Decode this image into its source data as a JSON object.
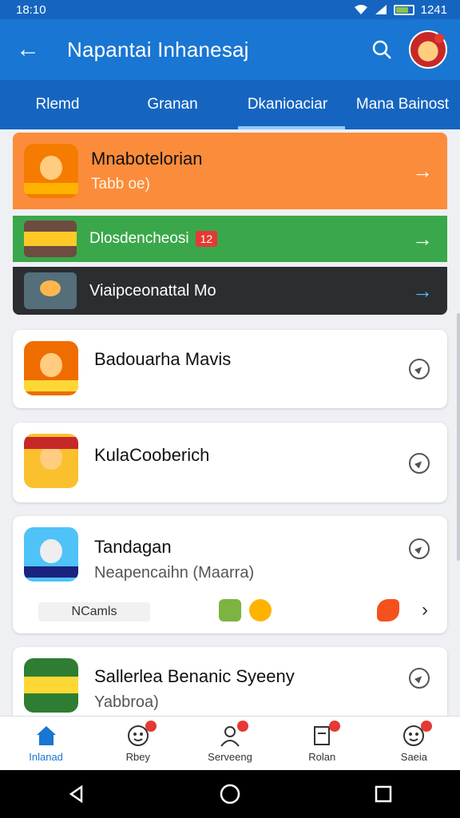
{
  "status": {
    "time": "18:10",
    "right_time": "1241"
  },
  "app_bar": {
    "title": "Napantai Inhanesaj"
  },
  "tabs": [
    {
      "label": "Rlemd"
    },
    {
      "label": "Granan"
    },
    {
      "label": "Dkanioaciar"
    },
    {
      "label": "Mana Bainost"
    }
  ],
  "banners": [
    {
      "title": "Mnabotelorian",
      "subtitle": "Tabb oe)",
      "color": "#fb8c3c"
    },
    {
      "title": "Dlosdencheosi",
      "badge": "12",
      "color": "#3aa84a"
    },
    {
      "title": "Viaipceonattal Mo",
      "color": "#2b2d30"
    }
  ],
  "cards": [
    {
      "title": "Badouarha Mavis"
    },
    {
      "title": "KulaCooberich"
    },
    {
      "title": "Tandagan",
      "subtitle": "Neapencaihn (Maarra)",
      "chip": "NCamls"
    },
    {
      "title": "Sallerlea Benanic Syeeny",
      "subtitle": "Yabbroa)"
    }
  ],
  "bottom_nav": [
    {
      "label": "Inlanad"
    },
    {
      "label": "Rbey"
    },
    {
      "label": "Serveeng"
    },
    {
      "label": "Rolan"
    },
    {
      "label": "Saeia"
    }
  ],
  "colors": {
    "primary": "#1976d2",
    "tabs": "#1565c0",
    "accent_orange": "#fb8c3c",
    "accent_green": "#3aa84a",
    "dark": "#2b2d30",
    "badge_red": "#e53935"
  }
}
